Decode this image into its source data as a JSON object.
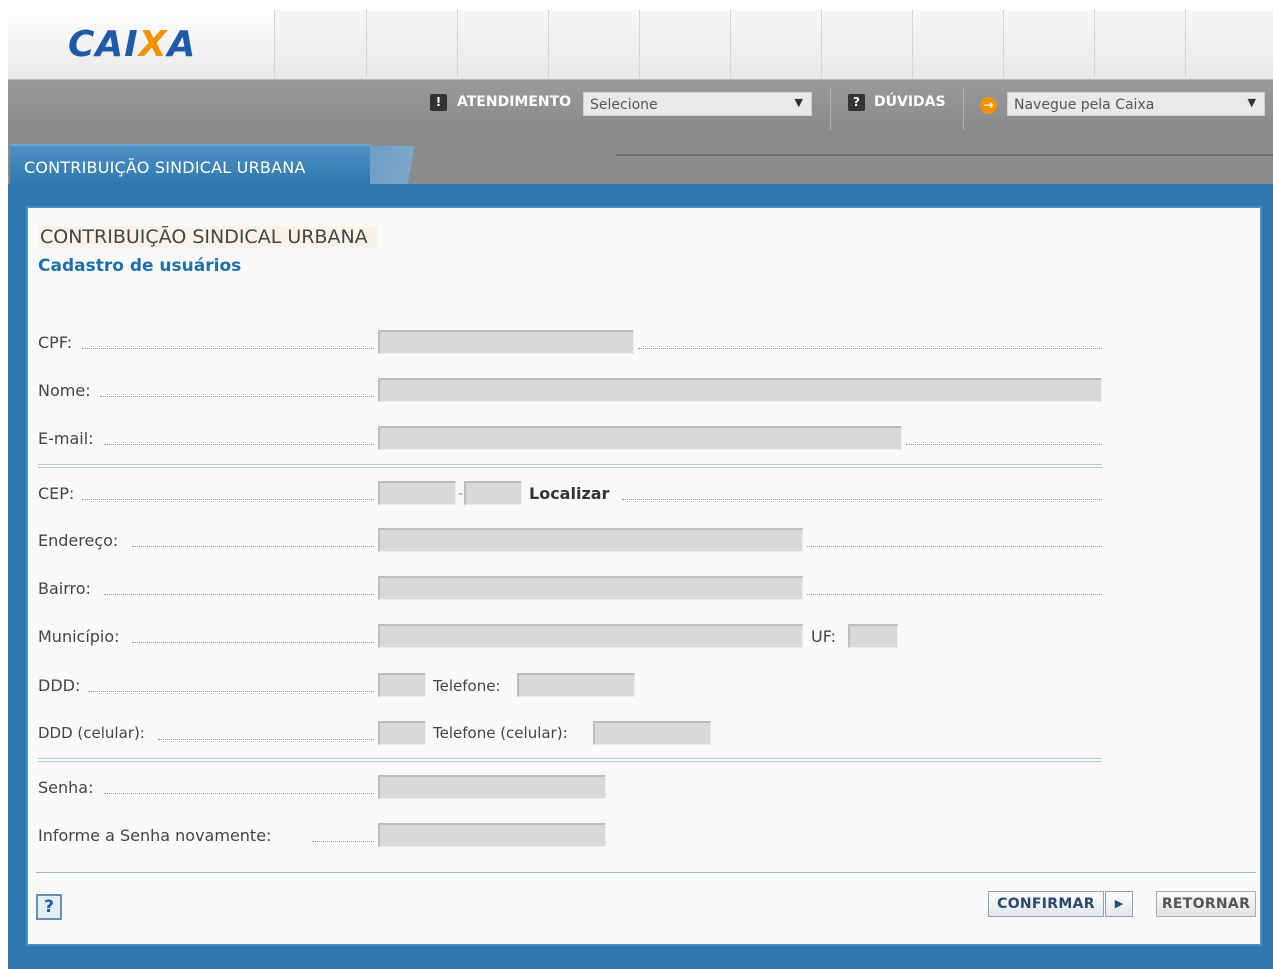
{
  "header": {
    "logo_text_a": "CAI",
    "logo_text_x": "X",
    "logo_text_b": "A"
  },
  "nav": {
    "atendimento_icon": "exclamation-icon",
    "atendimento_label": "ATENDIMENTO",
    "atendimento_select": "Selecione",
    "duvidas_icon": "question-icon",
    "duvidas_label": "DÚVIDAS",
    "navegue_icon": "arrow-right-icon",
    "navegue_select": "Navegue pela Caixa",
    "dropdown_arrow": "▼"
  },
  "tab": {
    "label": "CONTRIBUIÇÃO SINDICAL URBANA"
  },
  "page": {
    "title": "CONTRIBUIÇÃO SINDICAL URBANA",
    "subtitle": "Cadastro de usuários"
  },
  "form": {
    "cpf_label": "CPF:",
    "nome_label": "Nome:",
    "email_label": "E-mail:",
    "cep_label": "CEP:",
    "cep_separator": "-",
    "localizar_label": "Localizar",
    "endereco_label": "Endereço:",
    "bairro_label": "Bairro:",
    "municipio_label": "Município:",
    "uf_label": "UF:",
    "ddd_label": "DDD:",
    "telefone_label": "Telefone:",
    "ddd_celular_label": "DDD (celular):",
    "telefone_celular_label": "Telefone (celular):",
    "senha_label": "Senha:",
    "senha_confirm_label": "Informe a Senha novamente:"
  },
  "footer": {
    "help_label": "?",
    "confirm_label": "CONFIRMAR",
    "confirm_arrow": "▶",
    "retornar_label": "RETORNAR"
  },
  "colors": {
    "brand_blue": "#1f5aa6",
    "brand_orange": "#f39200",
    "panel_blue": "#2f78ad"
  }
}
